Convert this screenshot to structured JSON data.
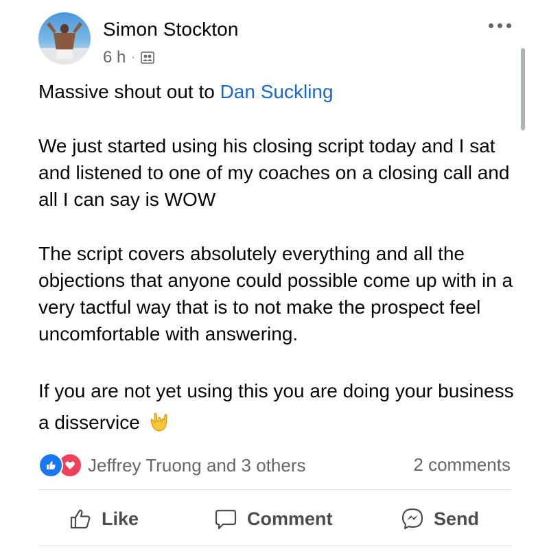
{
  "post": {
    "author": "Simon Stockton",
    "time": "6 h",
    "separator": "·",
    "privacy_icon": "friends-icon",
    "paragraphs": {
      "p1_prefix": "Massive shout out to ",
      "p1_mention": "Dan Suckling",
      "p2": "We just started using his closing script today and I sat and listened to one of my coaches on a closing call and all I can say is WOW",
      "p3": "The script covers absolutely everything and all the objections that anyone could possible come up with in a very tactful way that is to not make the prospect feel uncomfortable with answering.",
      "p4": "If you are not yet using this you are doing your business a disservice"
    },
    "emoji": "love-you-gesture-icon"
  },
  "engagement": {
    "reactions": [
      "like-icon",
      "love-icon"
    ],
    "reaction_text": "Jeffrey Truong and 3 others",
    "comments": "2 comments"
  },
  "actions": {
    "like": "Like",
    "comment": "Comment",
    "send": "Send"
  },
  "colors": {
    "mention": "#1a66c9",
    "like_blue": "#1877f2",
    "love_red": "#f0415c",
    "secondary_text": "#65676b"
  }
}
